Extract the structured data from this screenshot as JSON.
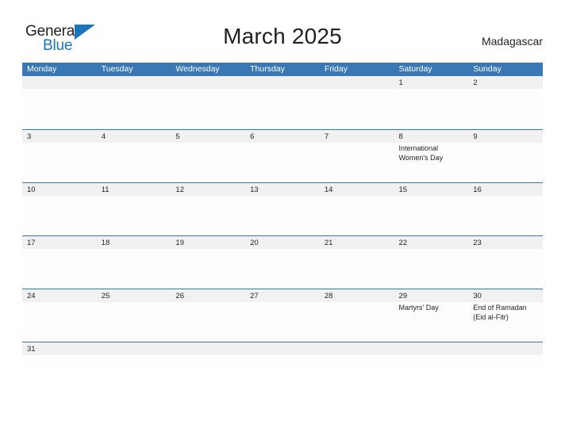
{
  "brand": {
    "name_part1": "General",
    "name_part2": "Blue",
    "flag_icon": "triangle-flag-icon",
    "color_primary": "#1b75bb",
    "color_text": "#231f20"
  },
  "header": {
    "title": "March 2025",
    "region": "Madagascar"
  },
  "calendar": {
    "accent_color": "#3a77b5",
    "band_color": "#f1f1f1",
    "day_names": [
      "Monday",
      "Tuesday",
      "Wednesday",
      "Thursday",
      "Friday",
      "Saturday",
      "Sunday"
    ],
    "weeks": [
      {
        "days": [
          {
            "num": "",
            "events": []
          },
          {
            "num": "",
            "events": []
          },
          {
            "num": "",
            "events": []
          },
          {
            "num": "",
            "events": []
          },
          {
            "num": "",
            "events": []
          },
          {
            "num": "1",
            "events": []
          },
          {
            "num": "2",
            "events": []
          }
        ]
      },
      {
        "days": [
          {
            "num": "3",
            "events": []
          },
          {
            "num": "4",
            "events": []
          },
          {
            "num": "5",
            "events": []
          },
          {
            "num": "6",
            "events": []
          },
          {
            "num": "7",
            "events": []
          },
          {
            "num": "8",
            "events": [
              "International\nWomen's Day"
            ]
          },
          {
            "num": "9",
            "events": []
          }
        ]
      },
      {
        "days": [
          {
            "num": "10",
            "events": []
          },
          {
            "num": "11",
            "events": []
          },
          {
            "num": "12",
            "events": []
          },
          {
            "num": "13",
            "events": []
          },
          {
            "num": "14",
            "events": []
          },
          {
            "num": "15",
            "events": []
          },
          {
            "num": "16",
            "events": []
          }
        ]
      },
      {
        "days": [
          {
            "num": "17",
            "events": []
          },
          {
            "num": "18",
            "events": []
          },
          {
            "num": "19",
            "events": []
          },
          {
            "num": "20",
            "events": []
          },
          {
            "num": "21",
            "events": []
          },
          {
            "num": "22",
            "events": []
          },
          {
            "num": "23",
            "events": []
          }
        ]
      },
      {
        "days": [
          {
            "num": "24",
            "events": []
          },
          {
            "num": "25",
            "events": []
          },
          {
            "num": "26",
            "events": []
          },
          {
            "num": "27",
            "events": []
          },
          {
            "num": "28",
            "events": []
          },
          {
            "num": "29",
            "events": [
              "Martyrs' Day"
            ]
          },
          {
            "num": "30",
            "events": [
              "End of Ramadan\n(Eid al-Fitr)"
            ]
          }
        ]
      },
      {
        "days": [
          {
            "num": "31",
            "events": []
          },
          {
            "num": "",
            "events": []
          },
          {
            "num": "",
            "events": []
          },
          {
            "num": "",
            "events": []
          },
          {
            "num": "",
            "events": []
          },
          {
            "num": "",
            "events": []
          },
          {
            "num": "",
            "events": []
          }
        ]
      }
    ]
  }
}
